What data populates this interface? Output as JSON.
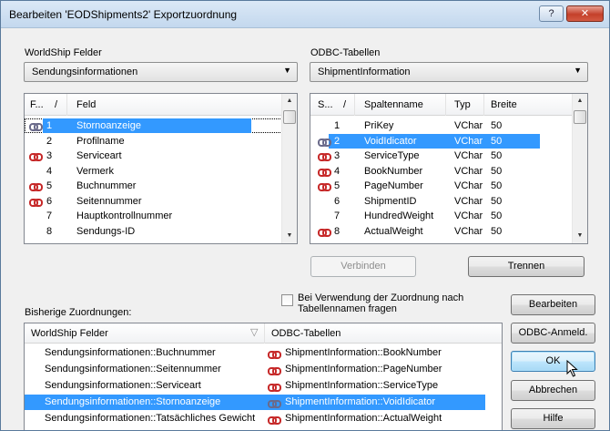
{
  "window": {
    "title": "Bearbeiten 'EODShipments2' Exportzuordnung",
    "help_label": "?",
    "close_label": "✕"
  },
  "left_panel": {
    "label": "WorldShip Felder",
    "combo_value": "Sendungsinformationen",
    "list_headers": [
      "F...",
      "/",
      "Feld"
    ],
    "rows": [
      {
        "num": "1",
        "name": "Stornoanzeige",
        "linked": true,
        "selected": true
      },
      {
        "num": "2",
        "name": "Profilname",
        "linked": false
      },
      {
        "num": "3",
        "name": "Serviceart",
        "linked": true
      },
      {
        "num": "4",
        "name": "Vermerk",
        "linked": false
      },
      {
        "num": "5",
        "name": "Buchnummer",
        "linked": true
      },
      {
        "num": "6",
        "name": "Seitennummer",
        "linked": true
      },
      {
        "num": "7",
        "name": "Hauptkontrollnummer",
        "linked": false
      },
      {
        "num": "8",
        "name": "Sendungs-ID",
        "linked": false
      }
    ]
  },
  "right_panel": {
    "label": "ODBC-Tabellen",
    "combo_value": "ShipmentInformation",
    "list_headers": [
      "S...",
      "/",
      "Spaltenname",
      "Typ",
      "Breite"
    ],
    "rows": [
      {
        "num": "1",
        "name": "PriKey",
        "type": "VChar",
        "width": "50",
        "linked": false
      },
      {
        "num": "2",
        "name": "VoidIdicator",
        "type": "VChar",
        "width": "50",
        "linked": true,
        "selected": true
      },
      {
        "num": "3",
        "name": "ServiceType",
        "type": "VChar",
        "width": "50",
        "linked": true
      },
      {
        "num": "4",
        "name": "BookNumber",
        "type": "VChar",
        "width": "50",
        "linked": true
      },
      {
        "num": "5",
        "name": "PageNumber",
        "type": "VChar",
        "width": "50",
        "linked": true
      },
      {
        "num": "6",
        "name": "ShipmentID",
        "type": "VChar",
        "width": "50",
        "linked": false
      },
      {
        "num": "7",
        "name": "HundredWeight",
        "type": "VChar",
        "width": "50",
        "linked": false
      },
      {
        "num": "8",
        "name": "ActualWeight",
        "type": "VChar",
        "width": "50",
        "linked": true
      }
    ]
  },
  "buttons": {
    "connect": "Verbinden",
    "disconnect": "Trennen",
    "edit": "Bearbeiten",
    "odbc_login": "ODBC-Anmeld.",
    "ok": "OK",
    "cancel": "Abbrechen",
    "help": "Hilfe"
  },
  "checkbox": {
    "label_line1": "Bei Verwendung der Zuordnung nach",
    "label_line2": "Tabellennamen fragen",
    "checked": false
  },
  "mappings": {
    "label": "Bisherige Zuordnungen:",
    "headers": [
      "WorldShip Felder",
      "ODBC-Tabellen"
    ],
    "rows": [
      {
        "left": "Sendungsinformationen::Buchnummer",
        "right": "ShipmentInformation::BookNumber"
      },
      {
        "left": "Sendungsinformationen::Seitennummer",
        "right": "ShipmentInformation::PageNumber"
      },
      {
        "left": "Sendungsinformationen::Serviceart",
        "right": "ShipmentInformation::ServiceType"
      },
      {
        "left": "Sendungsinformationen::Stornoanzeige",
        "right": "ShipmentInformation::VoidIdicator",
        "selected": true
      },
      {
        "left": "Sendungsinformationen::Tatsächliches Gewicht",
        "right": "ShipmentInformation::ActualWeight"
      }
    ]
  }
}
